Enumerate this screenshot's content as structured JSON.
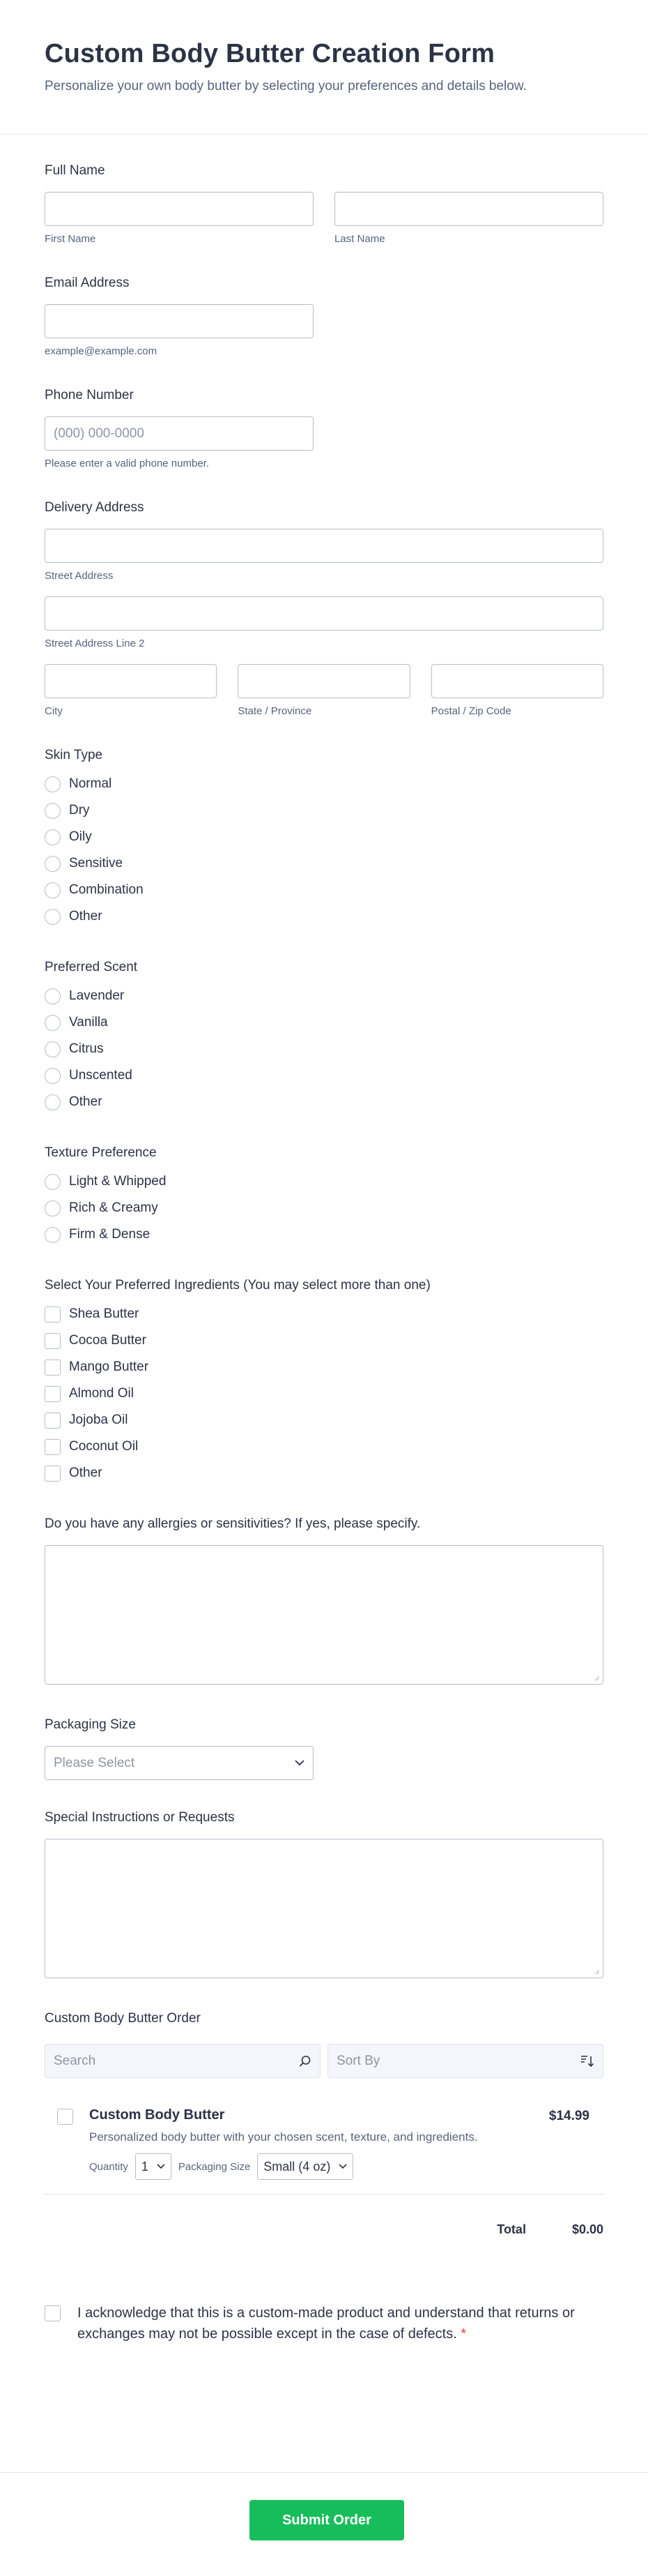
{
  "header": {
    "title": "Custom Body Butter Creation Form",
    "subtitle": "Personalize your own body butter by selecting your preferences and details below."
  },
  "full_name": {
    "label": "Full Name",
    "first_sub": "First Name",
    "last_sub": "Last Name"
  },
  "email": {
    "label": "Email Address",
    "sub": "example@example.com"
  },
  "phone": {
    "label": "Phone Number",
    "placeholder": "(000) 000-0000",
    "sub": "Please enter a valid phone number."
  },
  "address": {
    "label": "Delivery Address",
    "street": "Street Address",
    "street2": "Street Address Line 2",
    "city": "City",
    "state": "State / Province",
    "zip": "Postal / Zip Code"
  },
  "skin_type": {
    "label": "Skin Type",
    "options": [
      "Normal",
      "Dry",
      "Oily",
      "Sensitive",
      "Combination",
      "Other"
    ]
  },
  "scent": {
    "label": "Preferred Scent",
    "options": [
      "Lavender",
      "Vanilla",
      "Citrus",
      "Unscented",
      "Other"
    ]
  },
  "texture": {
    "label": "Texture Preference",
    "options": [
      "Light & Whipped",
      "Rich & Creamy",
      "Firm & Dense"
    ]
  },
  "ingredients": {
    "label": "Select Your Preferred Ingredients (You may select more than one)",
    "options": [
      "Shea Butter",
      "Cocoa Butter",
      "Mango Butter",
      "Almond Oil",
      "Jojoba Oil",
      "Coconut Oil",
      "Other"
    ]
  },
  "allergies": {
    "label": "Do you have any allergies or sensitivities? If yes, please specify."
  },
  "packaging": {
    "label": "Packaging Size",
    "placeholder": "Please Select"
  },
  "instructions": {
    "label": "Special Instructions or Requests"
  },
  "order": {
    "label": "Custom Body Butter Order",
    "search_placeholder": "Search",
    "sort_label": "Sort By",
    "product": {
      "name": "Custom Body Butter",
      "price": "$14.99",
      "description": "Personalized body butter with your chosen scent, texture, and ingredients.",
      "quantity_label": "Quantity",
      "quantity_value": "1",
      "size_label": "Packaging Size",
      "size_value": "Small (4 oz)"
    },
    "total_label": "Total",
    "total_value": "$0.00"
  },
  "acknowledge": {
    "text": "I acknowledge that this is a custom-made product and understand that returns or exchanges may not be possible except in the case of defects.",
    "required_mark": "*"
  },
  "submit_label": "Submit Order",
  "colors": {
    "accent": "#18bd5b",
    "required": "#f23a3c",
    "text": "#2c3345",
    "muted": "#57647e",
    "border": "#b8bdc9"
  }
}
